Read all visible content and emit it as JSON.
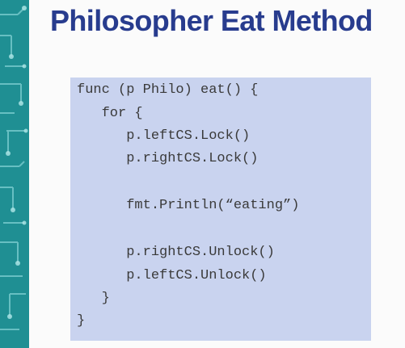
{
  "slide": {
    "title": "Philosopher Eat Method"
  },
  "code": {
    "lines": [
      "func (p Philo) eat() {",
      "   for {",
      "      p.leftCS.Lock()",
      "      p.rightCS.Lock()",
      "",
      "      fmt.Println(“eating”)",
      "",
      "      p.rightCS.Unlock()",
      "      p.leftCS.Unlock()",
      "   }",
      "}"
    ]
  },
  "colors": {
    "title": "#283c8e",
    "code_background": "#c9d3ef",
    "code_text": "#3a3a3a",
    "side_strip": "#1f8f93"
  }
}
